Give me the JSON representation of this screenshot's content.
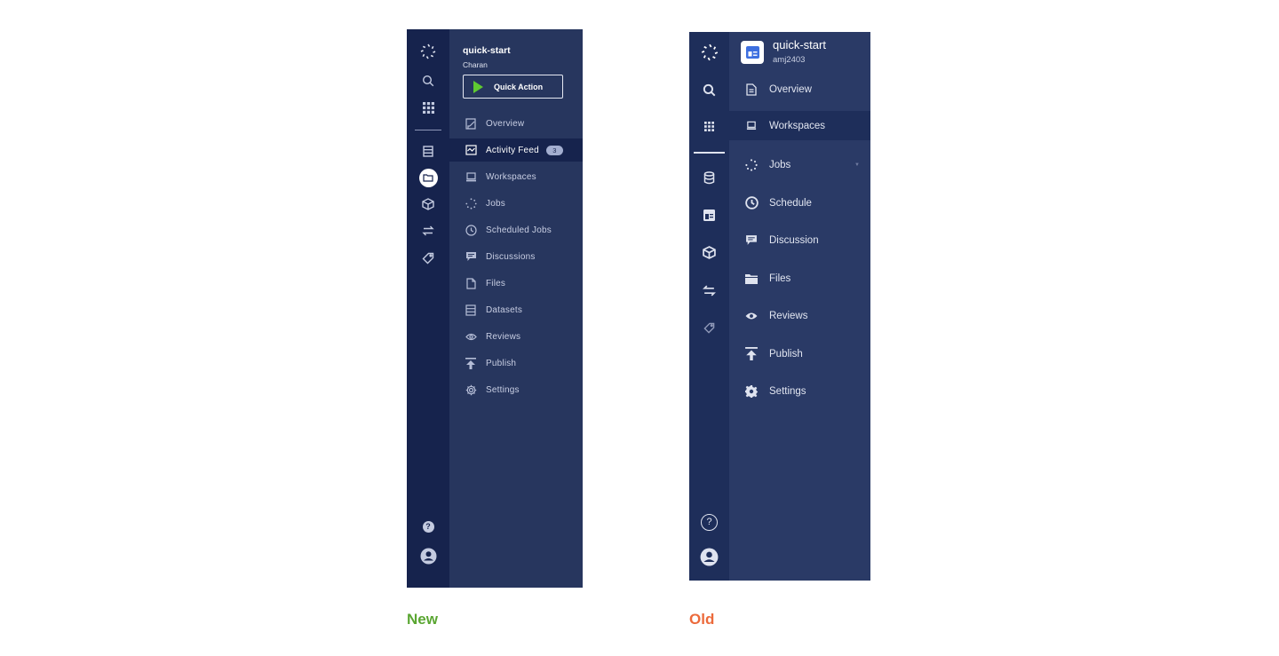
{
  "new_panel": {
    "caption": "New",
    "caption_color": "#5aa632",
    "project_title": "quick-start",
    "owner": "Charan",
    "quick_action_label": "Quick Action",
    "rail_icons": [
      "logo-icon",
      "search-icon",
      "apps-grid-icon",
      "datasets-icon",
      "projects-icon",
      "models-icon",
      "transfer-icon",
      "tag-icon",
      "help-icon",
      "user-icon"
    ],
    "nav": [
      {
        "label": "Overview",
        "icon": "overview-icon"
      },
      {
        "label": "Activity Feed",
        "icon": "activity-feed-icon",
        "badge": "3",
        "active": true
      },
      {
        "label": "Workspaces",
        "icon": "workspaces-icon"
      },
      {
        "label": "Jobs",
        "icon": "jobs-icon"
      },
      {
        "label": "Scheduled Jobs",
        "icon": "clock-icon"
      },
      {
        "label": "Discussions",
        "icon": "discussions-icon"
      },
      {
        "label": "Files",
        "icon": "file-icon"
      },
      {
        "label": "Datasets",
        "icon": "datasets-icon"
      },
      {
        "label": "Reviews",
        "icon": "eye-icon"
      },
      {
        "label": "Publish",
        "icon": "publish-icon"
      },
      {
        "label": "Settings",
        "icon": "gear-icon"
      }
    ]
  },
  "old_panel": {
    "caption": "Old",
    "caption_color": "#ec6a3b",
    "project_title": "quick-start",
    "owner": "amj2403",
    "rail_icons": [
      "logo-icon",
      "search-icon",
      "apps-grid-icon",
      "database-icon",
      "projects-icon",
      "models-icon",
      "transfer-icon",
      "tag-icon",
      "help-icon",
      "user-icon"
    ],
    "nav": [
      {
        "label": "Overview",
        "icon": "document-icon"
      },
      {
        "label": "Workspaces",
        "icon": "workspaces-icon",
        "active": true
      },
      {
        "label": "Jobs",
        "icon": "jobs-icon",
        "caret": "▼"
      },
      {
        "label": "Schedule",
        "icon": "clock-icon"
      },
      {
        "label": "Discussion",
        "icon": "discussion-icon"
      },
      {
        "label": "Files",
        "icon": "folder-icon"
      },
      {
        "label": "Reviews",
        "icon": "eye-icon"
      },
      {
        "label": "Publish",
        "icon": "publish-icon"
      },
      {
        "label": "Settings",
        "icon": "gear-icon"
      }
    ]
  }
}
